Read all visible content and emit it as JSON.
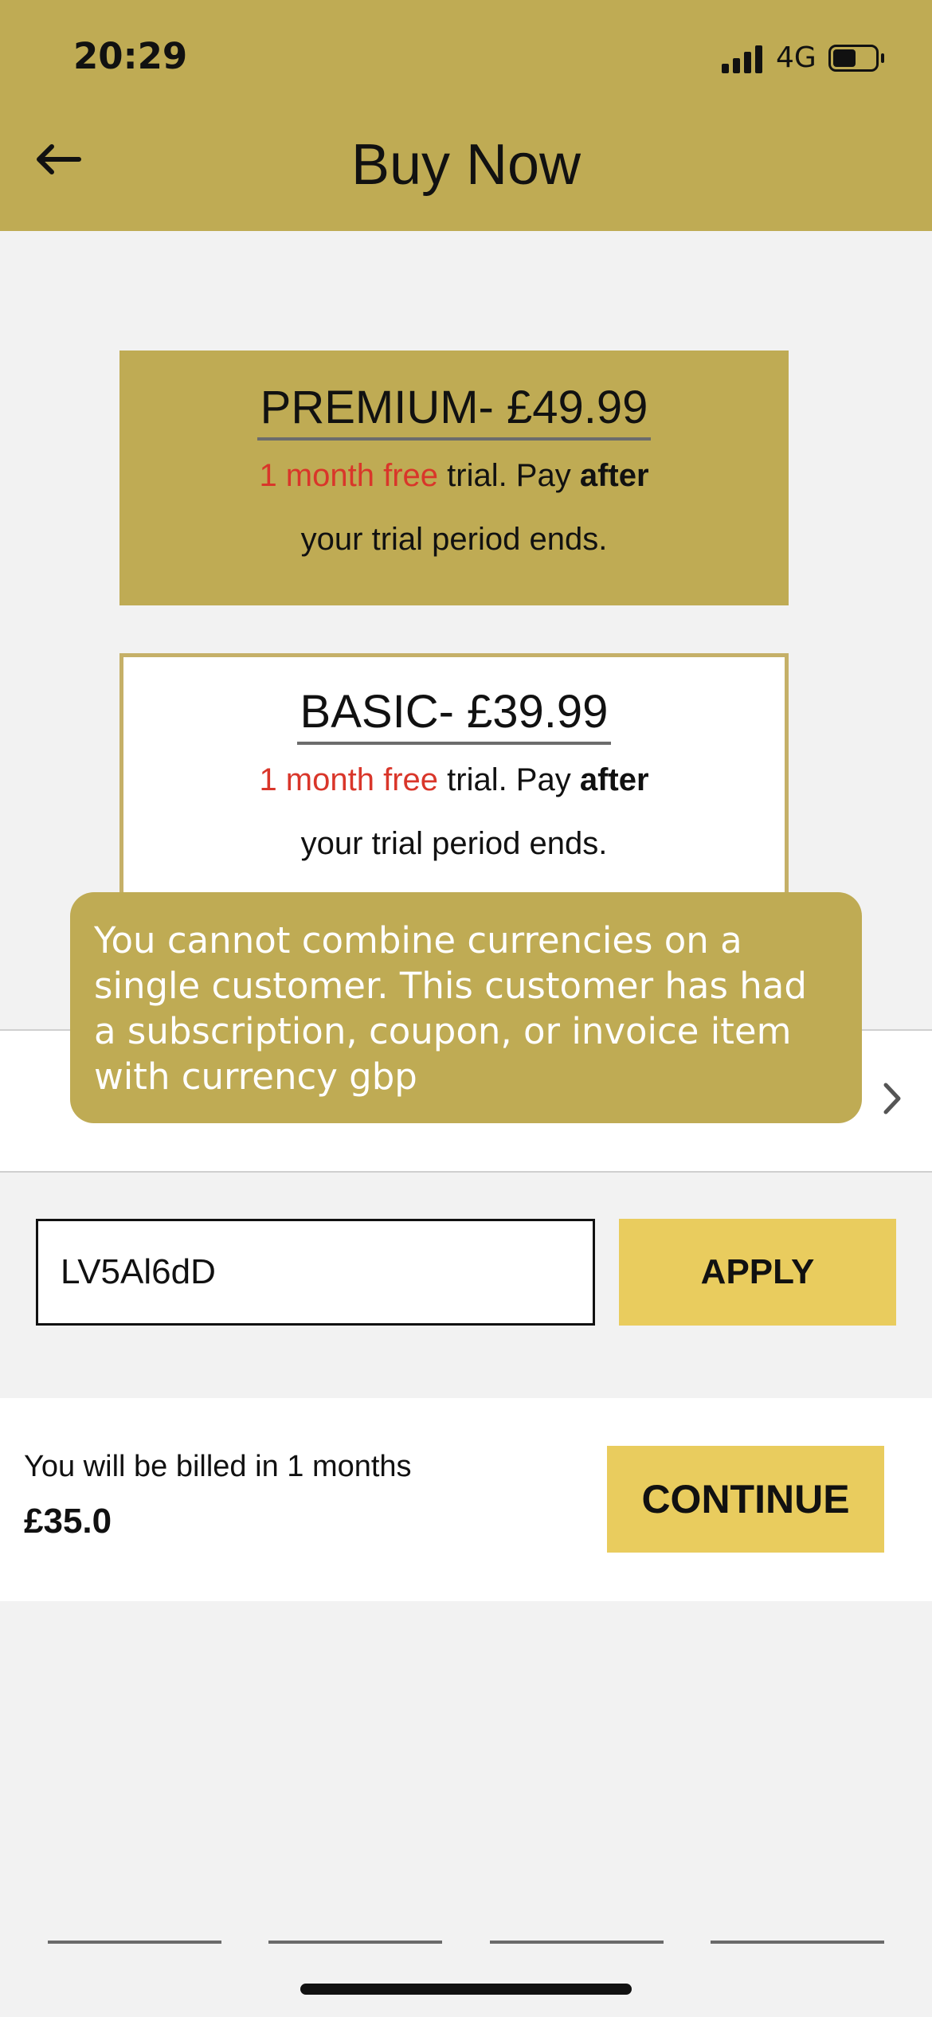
{
  "status_bar": {
    "time": "20:29",
    "network": "4G",
    "battery_level": 0.55
  },
  "header": {
    "title": "Buy Now",
    "back_icon": "arrow-left-icon"
  },
  "plans": [
    {
      "name": "PREMIUM- £49.99",
      "free_text": "1 month free",
      "desc_a": " trial. Pay ",
      "desc_bold": "after",
      "desc_line2": "your trial period ends.",
      "selected": true
    },
    {
      "name": "BASIC- £39.99",
      "free_text": "1 month free",
      "desc_a": " trial. Pay ",
      "desc_bold": "after",
      "desc_line2": "your trial period ends.",
      "selected": false
    }
  ],
  "toast": {
    "message": "You cannot combine currencies on a single customer. This customer has had a subscription, coupon, or invoice item with currency gbp"
  },
  "coupon": {
    "value": "LV5Al6dD",
    "apply_label": "APPLY"
  },
  "billing": {
    "text": "You will be billed in 1 months",
    "amount": "£35.0",
    "continue_label": "CONTINUE"
  },
  "colors": {
    "header_bg": "#bfab54",
    "button_bg": "#e9cc5e",
    "accent_red": "#d9362a"
  }
}
